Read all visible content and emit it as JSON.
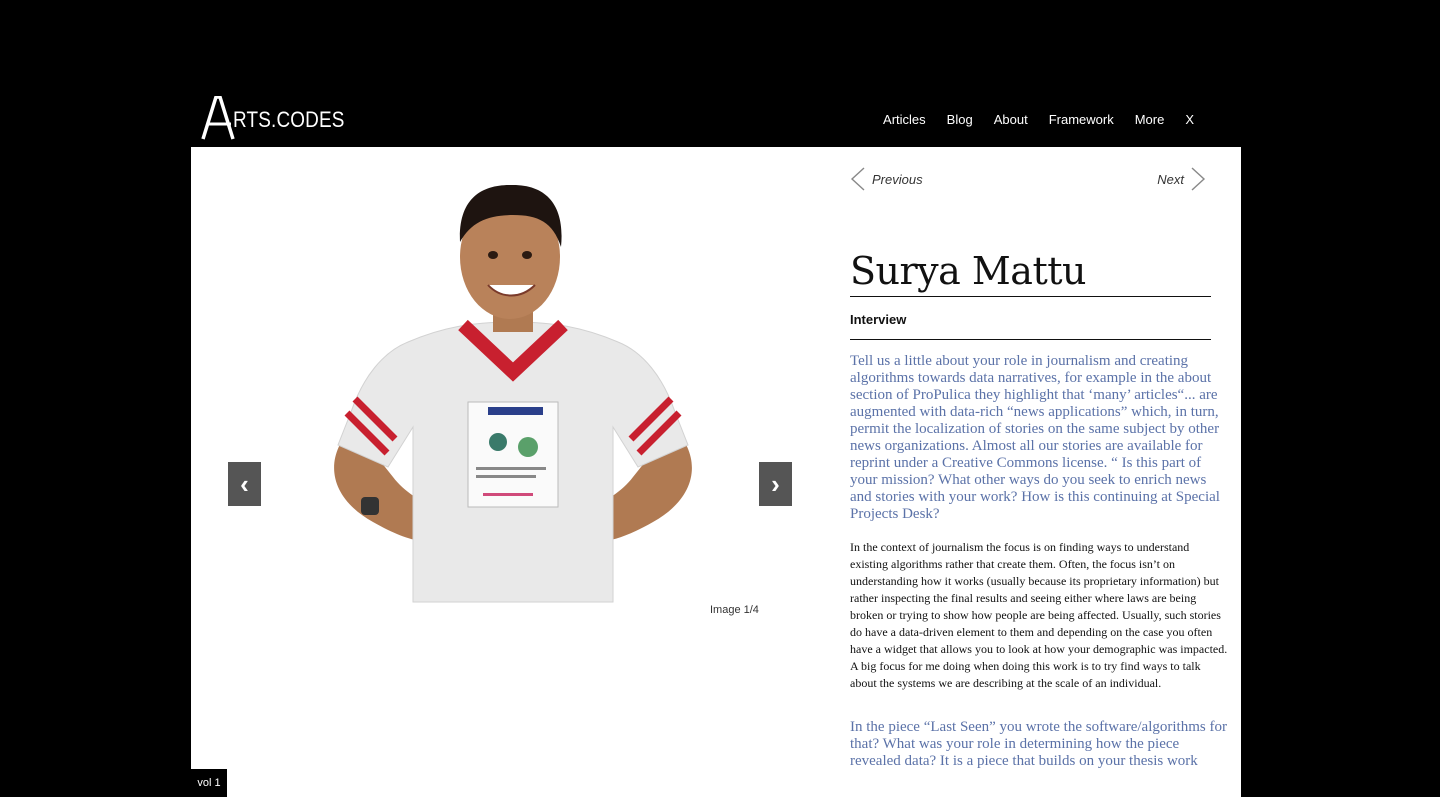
{
  "header": {
    "logo_text": "RTS.CODES",
    "nav": [
      "Articles",
      "Blog",
      "About",
      "Framework",
      "More",
      "X"
    ]
  },
  "gallery": {
    "prev_icon": "‹",
    "next_icon": "›",
    "counter": "Image 1/4"
  },
  "pager": {
    "previous": "Previous",
    "next": "Next"
  },
  "article": {
    "title": "Surya Mattu",
    "section": "Interview",
    "question1": "Tell us a little about your role in journalism and creating algorithms towards data narratives, for example in the about section of ProPulica they highlight that ‘many’ articles“... are augmented with data-rich “news applications” which, in turn, permit the localization of stories on the same subject by other news organizations. Almost all our stories are available for reprint under a Creative Commons license. “ Is this part of your mission? What other ways do you seek to enrich news and stories with your work? How is this continuing at Special Projects Desk?",
    "answer1": "In the context of journalism the focus is on finding ways to understand existing algorithms rather that create them. Often, the focus isn’t on understanding how it works (usually because its proprietary information) but rather inspecting the final results and seeing either where laws are being broken or trying to show how people are being affected. Usually, such stories do have a data-driven element to them and depending on the case you often have a widget that allows you to look at how your demographic was impacted. A big focus for me doing when doing this work is to try find ways to talk about the systems we are describing at the scale of an individual.",
    "question2": "In the piece “Last Seen” you wrote the software/algorithms for that? What was your role in determining how the piece revealed data? It is a piece that builds on your thesis work"
  },
  "footer": {
    "vol": "vol 1"
  },
  "colors": {
    "background": "#000000",
    "panel": "#ffffff",
    "question_text": "#5b72a8",
    "slide_button": "#555555",
    "shirt_trim": "#c8202f"
  }
}
